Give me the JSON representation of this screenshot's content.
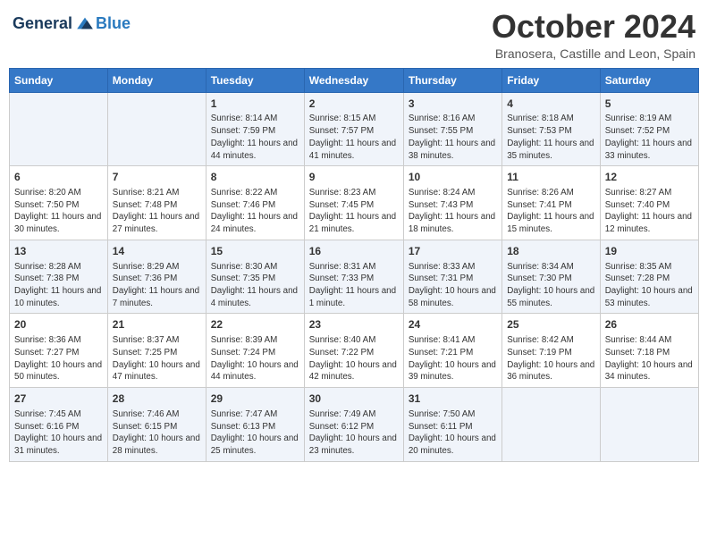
{
  "header": {
    "logo_general": "General",
    "logo_blue": "Blue",
    "month": "October 2024",
    "location": "Branosera, Castille and Leon, Spain"
  },
  "weekdays": [
    "Sunday",
    "Monday",
    "Tuesday",
    "Wednesday",
    "Thursday",
    "Friday",
    "Saturday"
  ],
  "weeks": [
    [
      {
        "day": "",
        "info": ""
      },
      {
        "day": "",
        "info": ""
      },
      {
        "day": "1",
        "info": "Sunrise: 8:14 AM\nSunset: 7:59 PM\nDaylight: 11 hours and 44 minutes."
      },
      {
        "day": "2",
        "info": "Sunrise: 8:15 AM\nSunset: 7:57 PM\nDaylight: 11 hours and 41 minutes."
      },
      {
        "day": "3",
        "info": "Sunrise: 8:16 AM\nSunset: 7:55 PM\nDaylight: 11 hours and 38 minutes."
      },
      {
        "day": "4",
        "info": "Sunrise: 8:18 AM\nSunset: 7:53 PM\nDaylight: 11 hours and 35 minutes."
      },
      {
        "day": "5",
        "info": "Sunrise: 8:19 AM\nSunset: 7:52 PM\nDaylight: 11 hours and 33 minutes."
      }
    ],
    [
      {
        "day": "6",
        "info": "Sunrise: 8:20 AM\nSunset: 7:50 PM\nDaylight: 11 hours and 30 minutes."
      },
      {
        "day": "7",
        "info": "Sunrise: 8:21 AM\nSunset: 7:48 PM\nDaylight: 11 hours and 27 minutes."
      },
      {
        "day": "8",
        "info": "Sunrise: 8:22 AM\nSunset: 7:46 PM\nDaylight: 11 hours and 24 minutes."
      },
      {
        "day": "9",
        "info": "Sunrise: 8:23 AM\nSunset: 7:45 PM\nDaylight: 11 hours and 21 minutes."
      },
      {
        "day": "10",
        "info": "Sunrise: 8:24 AM\nSunset: 7:43 PM\nDaylight: 11 hours and 18 minutes."
      },
      {
        "day": "11",
        "info": "Sunrise: 8:26 AM\nSunset: 7:41 PM\nDaylight: 11 hours and 15 minutes."
      },
      {
        "day": "12",
        "info": "Sunrise: 8:27 AM\nSunset: 7:40 PM\nDaylight: 11 hours and 12 minutes."
      }
    ],
    [
      {
        "day": "13",
        "info": "Sunrise: 8:28 AM\nSunset: 7:38 PM\nDaylight: 11 hours and 10 minutes."
      },
      {
        "day": "14",
        "info": "Sunrise: 8:29 AM\nSunset: 7:36 PM\nDaylight: 11 hours and 7 minutes."
      },
      {
        "day": "15",
        "info": "Sunrise: 8:30 AM\nSunset: 7:35 PM\nDaylight: 11 hours and 4 minutes."
      },
      {
        "day": "16",
        "info": "Sunrise: 8:31 AM\nSunset: 7:33 PM\nDaylight: 11 hours and 1 minute."
      },
      {
        "day": "17",
        "info": "Sunrise: 8:33 AM\nSunset: 7:31 PM\nDaylight: 10 hours and 58 minutes."
      },
      {
        "day": "18",
        "info": "Sunrise: 8:34 AM\nSunset: 7:30 PM\nDaylight: 10 hours and 55 minutes."
      },
      {
        "day": "19",
        "info": "Sunrise: 8:35 AM\nSunset: 7:28 PM\nDaylight: 10 hours and 53 minutes."
      }
    ],
    [
      {
        "day": "20",
        "info": "Sunrise: 8:36 AM\nSunset: 7:27 PM\nDaylight: 10 hours and 50 minutes."
      },
      {
        "day": "21",
        "info": "Sunrise: 8:37 AM\nSunset: 7:25 PM\nDaylight: 10 hours and 47 minutes."
      },
      {
        "day": "22",
        "info": "Sunrise: 8:39 AM\nSunset: 7:24 PM\nDaylight: 10 hours and 44 minutes."
      },
      {
        "day": "23",
        "info": "Sunrise: 8:40 AM\nSunset: 7:22 PM\nDaylight: 10 hours and 42 minutes."
      },
      {
        "day": "24",
        "info": "Sunrise: 8:41 AM\nSunset: 7:21 PM\nDaylight: 10 hours and 39 minutes."
      },
      {
        "day": "25",
        "info": "Sunrise: 8:42 AM\nSunset: 7:19 PM\nDaylight: 10 hours and 36 minutes."
      },
      {
        "day": "26",
        "info": "Sunrise: 8:44 AM\nSunset: 7:18 PM\nDaylight: 10 hours and 34 minutes."
      }
    ],
    [
      {
        "day": "27",
        "info": "Sunrise: 7:45 AM\nSunset: 6:16 PM\nDaylight: 10 hours and 31 minutes."
      },
      {
        "day": "28",
        "info": "Sunrise: 7:46 AM\nSunset: 6:15 PM\nDaylight: 10 hours and 28 minutes."
      },
      {
        "day": "29",
        "info": "Sunrise: 7:47 AM\nSunset: 6:13 PM\nDaylight: 10 hours and 25 minutes."
      },
      {
        "day": "30",
        "info": "Sunrise: 7:49 AM\nSunset: 6:12 PM\nDaylight: 10 hours and 23 minutes."
      },
      {
        "day": "31",
        "info": "Sunrise: 7:50 AM\nSunset: 6:11 PM\nDaylight: 10 hours and 20 minutes."
      },
      {
        "day": "",
        "info": ""
      },
      {
        "day": "",
        "info": ""
      }
    ]
  ]
}
